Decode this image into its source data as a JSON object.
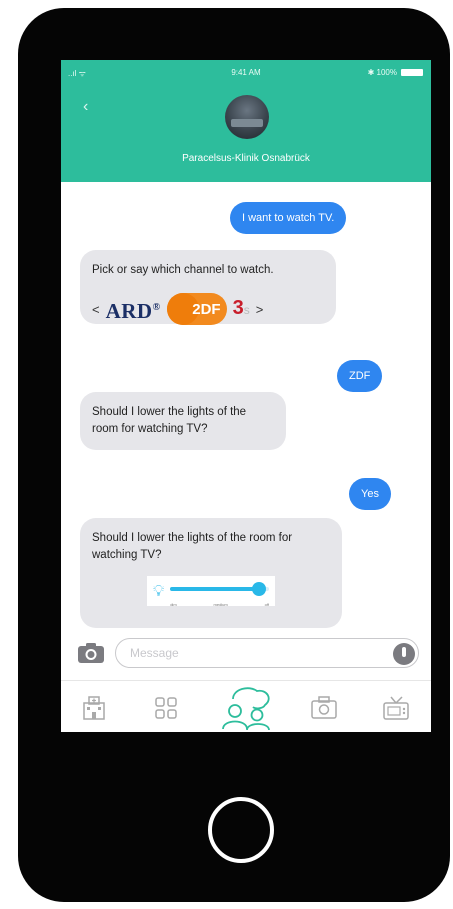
{
  "status_bar": {
    "signal": "..ıl ᯤ",
    "time": "9:41 AM",
    "battery": "✱ 100%"
  },
  "header": {
    "back_icon": "chevron-left-icon",
    "contact_name": "Paracelsus-Klinik Osnabrück"
  },
  "messages": [
    {
      "direction": "out",
      "text": "I want to watch TV."
    },
    {
      "direction": "in",
      "text": "Pick or say which channel to watch."
    },
    {
      "direction": "out",
      "text": "ZDF"
    },
    {
      "direction": "in",
      "text": "Should I lower the lights of the room for watching TV?"
    },
    {
      "direction": "out",
      "text": "Yes"
    },
    {
      "direction": "in",
      "text": "Should I lower the lights of the room for watching TV?"
    }
  ],
  "channels": {
    "prev": "<",
    "next": ">",
    "items": [
      {
        "name": "ARD",
        "mark": "®"
      },
      {
        "name": "ZDF",
        "label": "2DF"
      },
      {
        "name": "3sat",
        "label": "3",
        "small": "s"
      }
    ]
  },
  "light_slider": {
    "ticks": [
      "dim",
      "medium",
      "off"
    ],
    "level": 0.9
  },
  "composer": {
    "placeholder": "Message"
  },
  "tabs": [
    "hospital-icon",
    "grid-icon",
    "chat-people-icon",
    "camera-icon",
    "tv-icon"
  ],
  "colors": {
    "header": "#2dbd9c",
    "outgoing": "#2f86f0",
    "incoming": "#e6e6ea",
    "active_tab": "#2dbd9c"
  }
}
